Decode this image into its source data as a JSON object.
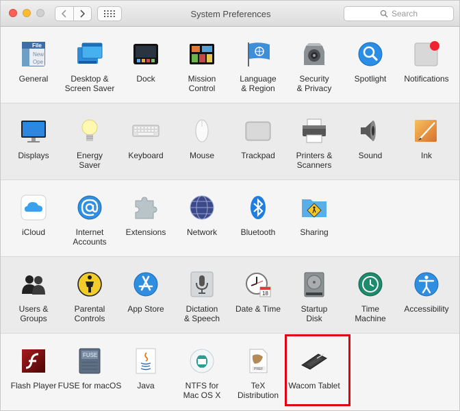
{
  "window": {
    "title": "System Preferences"
  },
  "search": {
    "placeholder": "Search"
  },
  "rows": [
    {
      "panes": [
        {
          "label_line1": "General",
          "label_line2": "",
          "icon": "general-icon"
        },
        {
          "label_line1": "Desktop &",
          "label_line2": "Screen Saver",
          "icon": "desktop-screen-saver-icon"
        },
        {
          "label_line1": "Dock",
          "label_line2": "",
          "icon": "dock-icon"
        },
        {
          "label_line1": "Mission",
          "label_line2": "Control",
          "icon": "mission-control-icon"
        },
        {
          "label_line1": "Language",
          "label_line2": "& Region",
          "icon": "language-region-icon"
        },
        {
          "label_line1": "Security",
          "label_line2": "& Privacy",
          "icon": "security-privacy-icon"
        },
        {
          "label_line1": "Spotlight",
          "label_line2": "",
          "icon": "spotlight-icon"
        },
        {
          "label_line1": "Notifications",
          "label_line2": "",
          "icon": "notifications-icon"
        }
      ]
    },
    {
      "panes": [
        {
          "label_line1": "Displays",
          "label_line2": "",
          "icon": "displays-icon"
        },
        {
          "label_line1": "Energy",
          "label_line2": "Saver",
          "icon": "energy-saver-icon"
        },
        {
          "label_line1": "Keyboard",
          "label_line2": "",
          "icon": "keyboard-icon"
        },
        {
          "label_line1": "Mouse",
          "label_line2": "",
          "icon": "mouse-icon"
        },
        {
          "label_line1": "Trackpad",
          "label_line2": "",
          "icon": "trackpad-icon"
        },
        {
          "label_line1": "Printers &",
          "label_line2": "Scanners",
          "icon": "printers-scanners-icon"
        },
        {
          "label_line1": "Sound",
          "label_line2": "",
          "icon": "sound-icon"
        },
        {
          "label_line1": "Ink",
          "label_line2": "",
          "icon": "ink-icon"
        }
      ]
    },
    {
      "panes": [
        {
          "label_line1": "iCloud",
          "label_line2": "",
          "icon": "icloud-icon"
        },
        {
          "label_line1": "Internet",
          "label_line2": "Accounts",
          "icon": "internet-accounts-icon"
        },
        {
          "label_line1": "Extensions",
          "label_line2": "",
          "icon": "extensions-icon"
        },
        {
          "label_line1": "Network",
          "label_line2": "",
          "icon": "network-icon"
        },
        {
          "label_line1": "Bluetooth",
          "label_line2": "",
          "icon": "bluetooth-icon"
        },
        {
          "label_line1": "Sharing",
          "label_line2": "",
          "icon": "sharing-icon"
        }
      ]
    },
    {
      "panes": [
        {
          "label_line1": "Users &",
          "label_line2": "Groups",
          "icon": "users-groups-icon"
        },
        {
          "label_line1": "Parental",
          "label_line2": "Controls",
          "icon": "parental-controls-icon"
        },
        {
          "label_line1": "App Store",
          "label_line2": "",
          "icon": "app-store-icon"
        },
        {
          "label_line1": "Dictation",
          "label_line2": "& Speech",
          "icon": "dictation-speech-icon"
        },
        {
          "label_line1": "Date & Time",
          "label_line2": "",
          "icon": "date-time-icon"
        },
        {
          "label_line1": "Startup",
          "label_line2": "Disk",
          "icon": "startup-disk-icon"
        },
        {
          "label_line1": "Time",
          "label_line2": "Machine",
          "icon": "time-machine-icon"
        },
        {
          "label_line1": "Accessibility",
          "label_line2": "",
          "icon": "accessibility-icon"
        }
      ]
    },
    {
      "panes": [
        {
          "label_line1": "Flash Player",
          "label_line2": "",
          "icon": "flash-player-icon"
        },
        {
          "label_line1": "FUSE for macOS",
          "label_line2": "",
          "icon": "fuse-icon"
        },
        {
          "label_line1": "Java",
          "label_line2": "",
          "icon": "java-icon"
        },
        {
          "label_line1": "NTFS for",
          "label_line2": "Mac OS X",
          "icon": "ntfs-icon"
        },
        {
          "label_line1": "TeX",
          "label_line2": "Distribution",
          "icon": "tex-distribution-icon"
        },
        {
          "label_line1": "Wacom Tablet",
          "label_line2": "",
          "icon": "wacom-tablet-icon"
        }
      ]
    }
  ],
  "icon_text": {
    "general_file": "File",
    "general_new": "New",
    "general_ope": "Ope",
    "fuse": "FUSE",
    "calendar_day": "18",
    "tex_pref": "PREF"
  },
  "highlight": {
    "target": "Wacom Tablet",
    "color": "#e3000f"
  }
}
